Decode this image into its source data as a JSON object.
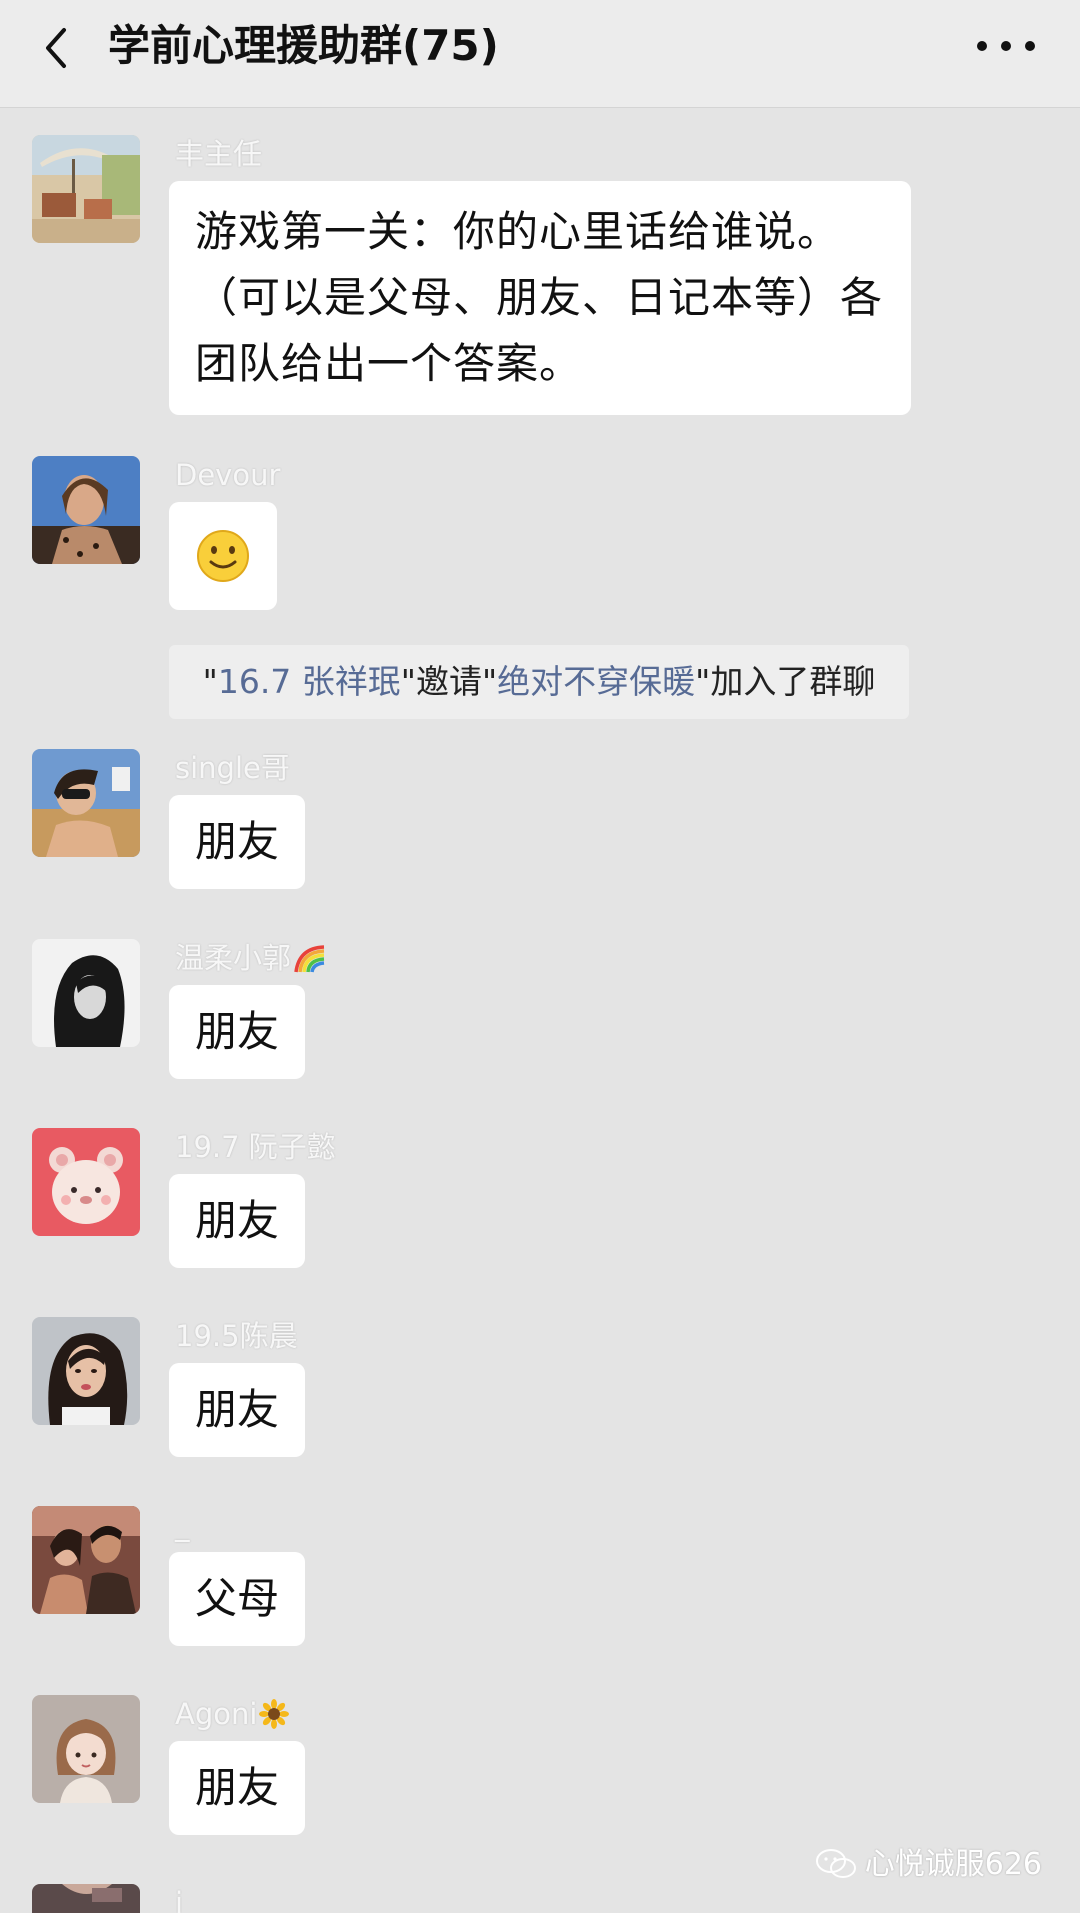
{
  "header": {
    "title": "学前心理援助群(75)",
    "back_icon": "chevron-left-icon",
    "more_icon": "more-dots-icon"
  },
  "messages": [
    {
      "sender": "丰主任",
      "text": "游戏第一关：你的心里话给谁说。（可以是父母、朋友、日记本等）各团队给出一个答案。",
      "avatar": "patio-photo"
    },
    {
      "sender": "Devour",
      "emoji": "smile-emoji",
      "avatar": "woman-photo"
    },
    {
      "sender": "single哥",
      "text": "朋友",
      "avatar": "girl-sunglasses-photo"
    },
    {
      "sender": "温柔小郭",
      "sender_badge": "rainbow-icon",
      "text": "朋友",
      "avatar": "bw-portrait-photo"
    },
    {
      "sender": "19.7 阮子懿",
      "text": "朋友",
      "avatar": "cartoon-bear-photo"
    },
    {
      "sender": "19.5陈晨",
      "text": "朋友",
      "avatar": "girl-portrait-photo"
    },
    {
      "sender": "_",
      "text": "父母",
      "avatar": "couple-photo"
    },
    {
      "sender": "Agoni",
      "sender_badge": "sunflower-icon",
      "text": "朋友",
      "avatar": "cartoon-girl-photo"
    },
    {
      "sender": "i",
      "avatar": "partial-photo"
    }
  ],
  "system_message": {
    "q1": "\"",
    "inviter": "16.7 张祥珉",
    "q2": "\"",
    "verb": "邀请",
    "q3": "\"",
    "invitee": "绝对不穿保暖",
    "q4": "\"",
    "suffix": "加入了群聊"
  },
  "watermark": "心悦诚服626",
  "colors": {
    "link": "#576b95",
    "bubble": "#ffffff",
    "background": "#e4e4e4"
  }
}
